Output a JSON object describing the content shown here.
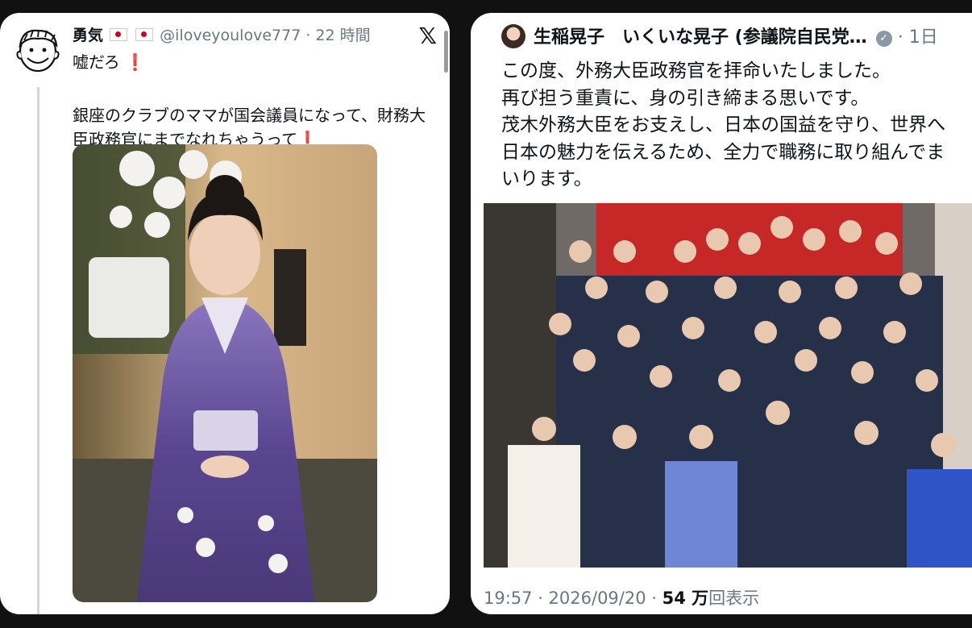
{
  "left_tweet": {
    "display_name": "勇気",
    "handle": "@iloveyoulove777",
    "time": "22 時間",
    "top_text": "嘘だろ",
    "quote_line1": "銀座のクラブのママが国会議員になって、財務大",
    "quote_line2": "臣政務官にまでなれちゃうって",
    "x_logo": "𝕏"
  },
  "right_tweet": {
    "display_name": "生稲晃子　いくいな晃子 (参議院自民党…",
    "time": "1日",
    "body": [
      "この度、外務大臣政務官を拝命いたしました。",
      "再び担う重責に、身の引き締まる思いです。",
      "茂木外務大臣をお支えし、日本の国益を守り、世界へ",
      "日本の魅力を伝えるため、全力で職務に取り組んでま",
      "いります。"
    ],
    "footer_time": "19:57 · 2026/09/20 · ",
    "view_count": "54 万",
    "views_label": "回表示"
  }
}
